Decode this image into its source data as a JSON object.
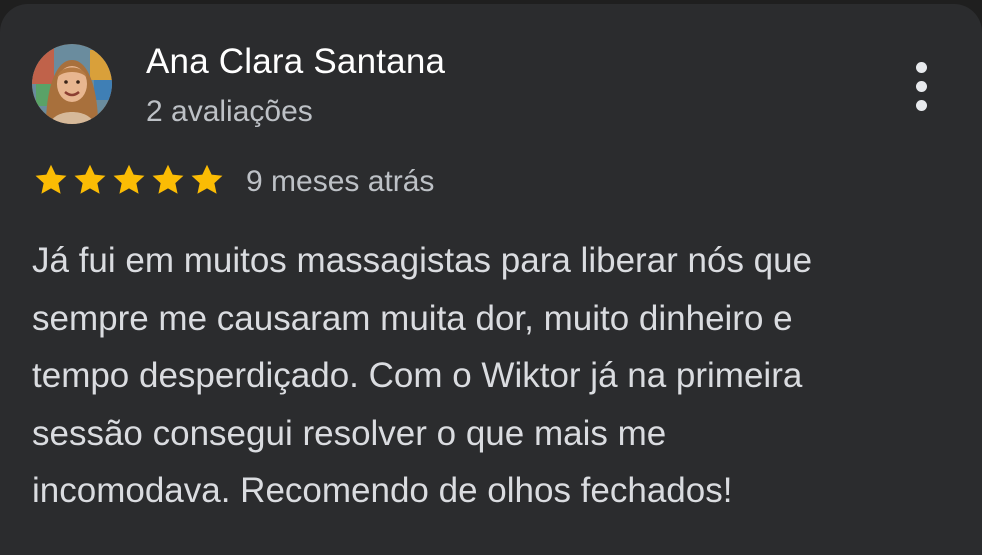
{
  "review": {
    "author": {
      "name": "Ana Clara Santana",
      "review_count": "2 avaliações",
      "avatar": "avatar-photo"
    },
    "rating": 5,
    "rating_max": 5,
    "time_ago": "9 meses atrás",
    "text_lines": [
      "Já fui em muitos massagistas para liberar nós que",
      "sempre me causaram muita dor, muito dinheiro e",
      "tempo desperdiçado. Com o Wiktor já na primeira",
      "sessão consegui resolver o que mais me",
      "incomodava. Recomendo de olhos fechados!"
    ],
    "menu_icon": "more-vert-icon"
  },
  "colors": {
    "background": "#2b2c2e",
    "star": "#fbbc04",
    "text_primary": "#ffffff",
    "text_secondary": "#bdc1c6"
  }
}
